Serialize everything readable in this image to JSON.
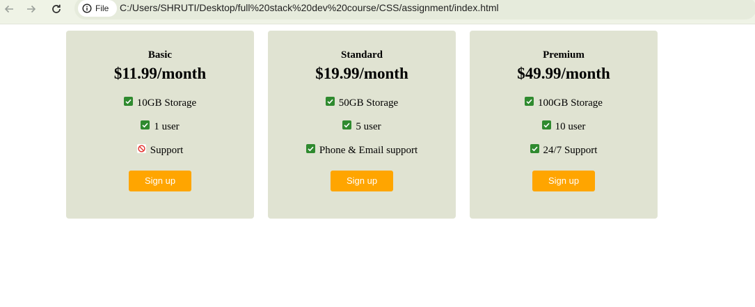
{
  "browser": {
    "site_chip_label": "File",
    "url": "C:/Users/SHRUTI/Desktop/full%20stack%20dev%20course/CSS/assignment/index.html",
    "icons": {
      "back": "arrow-left-icon",
      "forward": "arrow-right-icon",
      "reload": "reload-icon",
      "site_info": "info-icon"
    }
  },
  "colors": {
    "card_background": "#e0e3d2",
    "button_background": "#ffa500",
    "button_text": "#ffffff",
    "check_green": "#2f8a2f",
    "prohibited_red": "#e53935"
  },
  "plans": [
    {
      "name": "Basic",
      "price": "$11.99/month",
      "features": [
        {
          "text": "10GB Storage",
          "icon": "check-icon"
        },
        {
          "text": "1 user",
          "icon": "check-icon"
        },
        {
          "text": "Support",
          "icon": "prohibited-icon"
        }
      ],
      "button_label": "Sign up"
    },
    {
      "name": "Standard",
      "price": "$19.99/month",
      "features": [
        {
          "text": "50GB Storage",
          "icon": "check-icon"
        },
        {
          "text": "5 user",
          "icon": "check-icon"
        },
        {
          "text": "Phone & Email support",
          "icon": "check-icon"
        }
      ],
      "button_label": "Sign up"
    },
    {
      "name": "Premium",
      "price": "$49.99/month",
      "features": [
        {
          "text": "100GB Storage",
          "icon": "check-icon"
        },
        {
          "text": "10 user",
          "icon": "check-icon"
        },
        {
          "text": "24/7 Support",
          "icon": "check-icon"
        }
      ],
      "button_label": "Sign up"
    }
  ]
}
